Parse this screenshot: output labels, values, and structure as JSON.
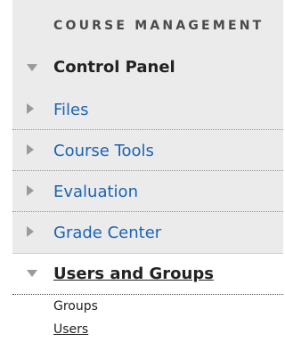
{
  "panel": {
    "section_title": "COURSE MANAGEMENT",
    "control_panel_label": "Control Panel",
    "items": [
      {
        "label": "Files"
      },
      {
        "label": "Course Tools"
      },
      {
        "label": "Evaluation"
      },
      {
        "label": "Grade Center"
      }
    ],
    "users_groups": {
      "label": "Users and Groups",
      "sub_items": [
        {
          "label": "Groups"
        },
        {
          "label": "Users"
        }
      ]
    }
  },
  "colors": {
    "link": "#1b63b3",
    "panel_bg": "#ebebeb"
  }
}
